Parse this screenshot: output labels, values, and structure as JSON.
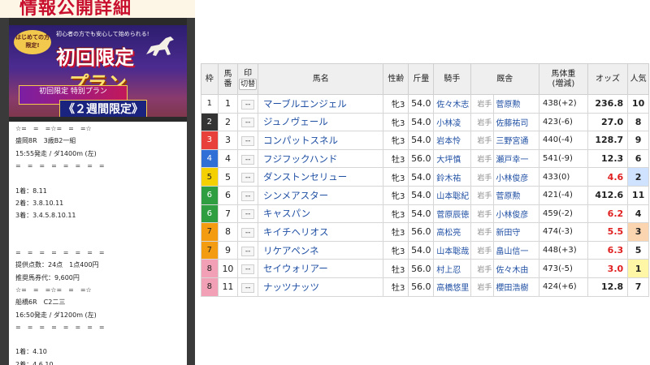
{
  "left_panel": {
    "banner_title": "情報公開詳細",
    "promo": {
      "badge": "はじめての方限定!",
      "tagline": "初心者の方でも安心して始められる!",
      "headline": "初回限定",
      "plan": "プラン",
      "sub": "初回限定 特別プラン",
      "weeks": "《２週間限定》"
    },
    "lines": [
      "☆=　=　=☆=　=　=☆",
      "盛岡8R　3歳B2一組",
      "15:55発走 / ダ1400m (左)",
      "=　=　=　=　=　=　=　=",
      "",
      "1着：8.11",
      "2着：3.8.10.11",
      "3着：3.4.5.8.10.11",
      "",
      "",
      "=　=　=　=　=　=　=　=",
      "提供点数：24点　1点400円",
      "推奨馬券代：9,600円",
      "☆=　=　=☆=　=　=☆",
      "船橋6R　C2二三",
      "16:50発走 / ダ1200m (左)",
      "=　=　=　=　=　=　=　=",
      "",
      "1着：4.10",
      "2着：4.6.10"
    ]
  },
  "table": {
    "headers": {
      "waku": "枠",
      "umaban_1": "馬",
      "umaban_2": "番",
      "mark_1": "印",
      "mark_2": "切替",
      "name": "馬名",
      "sex_age": "性齢",
      "kinryo": "斤量",
      "jockey": "騎手",
      "trainer": "厩舎",
      "weight_1": "馬体重",
      "weight_2": "(増減)",
      "odds": "オッズ",
      "pop": "人気"
    },
    "mark_placeholder": "--",
    "colors": {
      "waku_1": "#ffffff",
      "waku_2": "#333333",
      "waku_3": "#e8413c",
      "waku_4": "#2f6fd6",
      "waku_5": "#f5d000",
      "waku_6": "#2e9e40",
      "waku_7": "#f39c12",
      "waku_8": "#f2a0b5",
      "pop_1": "#fff7a6",
      "pop_2": "#cfe2ff",
      "pop_3": "#fbd5b0",
      "odds_red": "#e02020"
    },
    "rows": [
      {
        "waku": "1",
        "umaban": "1",
        "name": "マーブルエンジェル",
        "sex_age": "牝3",
        "kinryo": "54.0",
        "jockey": "佐々木志",
        "region": "岩手",
        "trainer": "菅原勲",
        "weight": "438(+2)",
        "odds": "236.8",
        "pop": "10"
      },
      {
        "waku": "2",
        "umaban": "2",
        "name": "ジュノヴェール",
        "sex_age": "牝3",
        "kinryo": "54.0",
        "jockey": "小林凌",
        "region": "岩手",
        "trainer": "佐藤祐司",
        "weight": "423(-6)",
        "odds": "27.0",
        "pop": "8"
      },
      {
        "waku": "3",
        "umaban": "3",
        "name": "コンパットスネル",
        "sex_age": "牝3",
        "kinryo": "54.0",
        "jockey": "岩本怜",
        "region": "岩手",
        "trainer": "三野宮通",
        "weight": "440(-4)",
        "odds": "128.7",
        "pop": "9"
      },
      {
        "waku": "4",
        "umaban": "4",
        "name": "フジフックハンド",
        "sex_age": "牡3",
        "kinryo": "56.0",
        "jockey": "大坪慎",
        "region": "岩手",
        "trainer": "瀬戸幸一",
        "weight": "541(-9)",
        "odds": "12.3",
        "pop": "6"
      },
      {
        "waku": "5",
        "umaban": "5",
        "name": "ダンストンセリュー",
        "sex_age": "牝3",
        "kinryo": "54.0",
        "jockey": "鈴木祐",
        "region": "岩手",
        "trainer": "小林俊彦",
        "weight": "433(0)",
        "odds": "4.6",
        "pop": "2"
      },
      {
        "waku": "6",
        "umaban": "6",
        "name": "シンメアスター",
        "sex_age": "牝3",
        "kinryo": "54.0",
        "jockey": "山本聡紀",
        "region": "岩手",
        "trainer": "菅原勲",
        "weight": "421(-4)",
        "odds": "412.6",
        "pop": "11"
      },
      {
        "waku": "6",
        "umaban": "7",
        "name": "キャスパン",
        "sex_age": "牝3",
        "kinryo": "54.0",
        "jockey": "菅原辰徳",
        "region": "岩手",
        "trainer": "小林俊彦",
        "weight": "459(-2)",
        "odds": "6.2",
        "pop": "4"
      },
      {
        "waku": "7",
        "umaban": "8",
        "name": "キイチヘリオス",
        "sex_age": "牡3",
        "kinryo": "56.0",
        "jockey": "高松亮",
        "region": "岩手",
        "trainer": "新田守",
        "weight": "474(-3)",
        "odds": "5.5",
        "pop": "3"
      },
      {
        "waku": "7",
        "umaban": "9",
        "name": "リケアペンネ",
        "sex_age": "牝3",
        "kinryo": "54.0",
        "jockey": "山本聡哉",
        "region": "岩手",
        "trainer": "畠山信一",
        "weight": "448(+3)",
        "odds": "6.3",
        "pop": "5"
      },
      {
        "waku": "8",
        "umaban": "10",
        "name": "セイウォリアー",
        "sex_age": "牡3",
        "kinryo": "56.0",
        "jockey": "村上忍",
        "region": "岩手",
        "trainer": "佐々木由",
        "weight": "473(-5)",
        "odds": "3.0",
        "pop": "1"
      },
      {
        "waku": "8",
        "umaban": "11",
        "name": "ナッツナッツ",
        "sex_age": "牡3",
        "kinryo": "56.0",
        "jockey": "高橋悠里",
        "region": "岩手",
        "trainer": "櫻田浩樹",
        "weight": "424(+6)",
        "odds": "12.8",
        "pop": "7"
      }
    ]
  }
}
